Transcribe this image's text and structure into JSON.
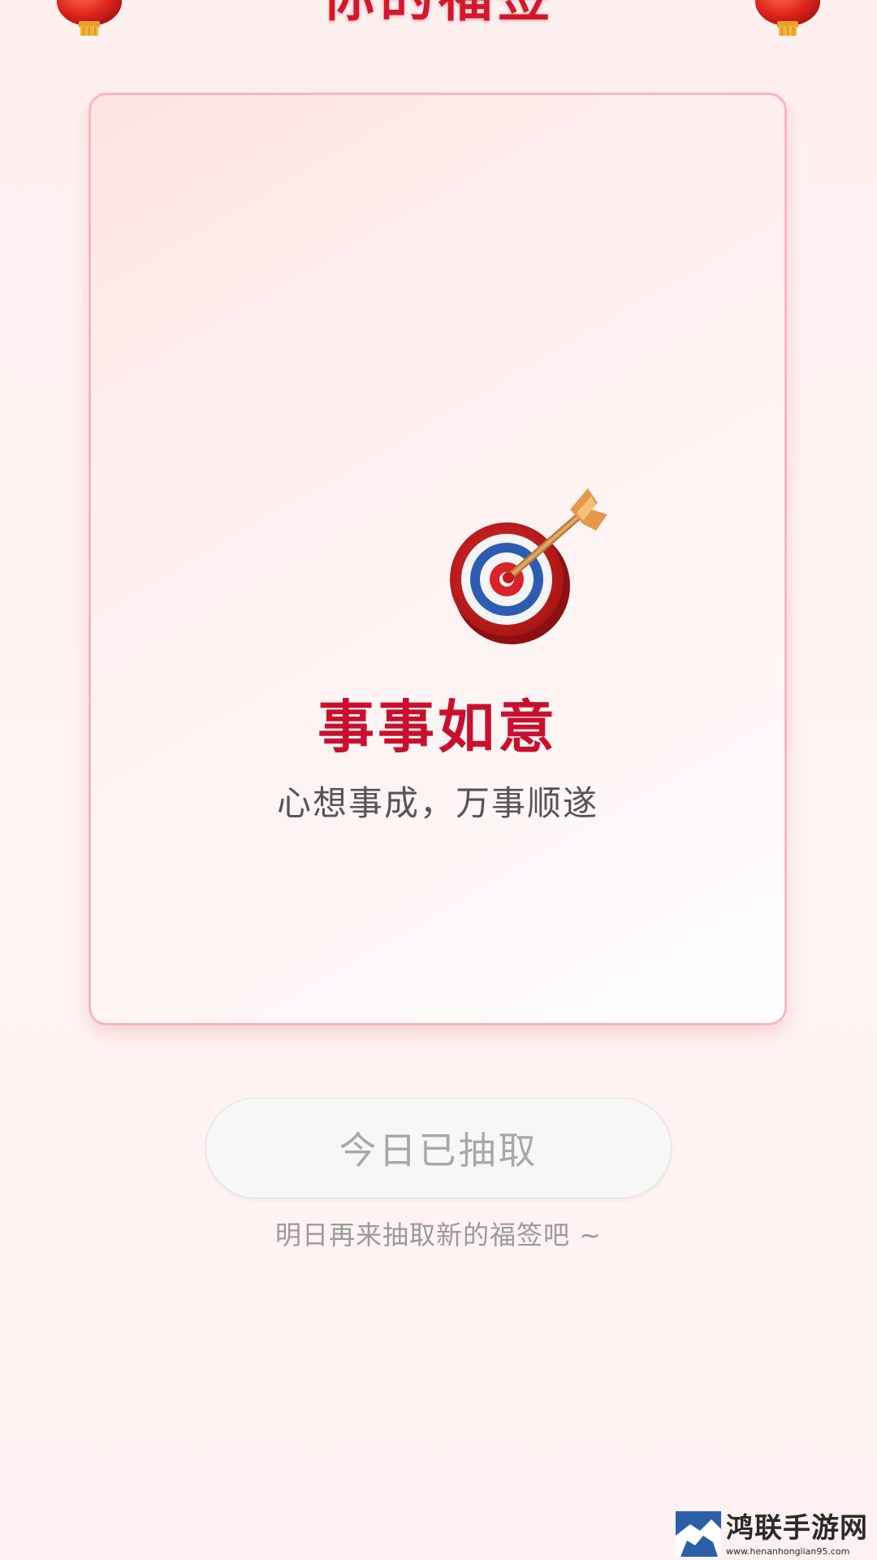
{
  "header": {
    "title": "你的福签"
  },
  "card": {
    "icon": "target-with-arrow-icon",
    "title": "事事如意",
    "description": "心想事成，万事顺遂"
  },
  "actions": {
    "draw_button_label": "今日已抽取",
    "hint": "明日再来抽取新的福签吧 ~"
  },
  "watermark": {
    "name": "鸿联手游网",
    "url": "www.henanhonglian95.com"
  },
  "colors": {
    "background": "#fff1f1",
    "accent": "#c8102e",
    "card_border": "#f6b7bf",
    "button_bg": "#f7f7f7",
    "button_text": "#a8a8a8"
  }
}
